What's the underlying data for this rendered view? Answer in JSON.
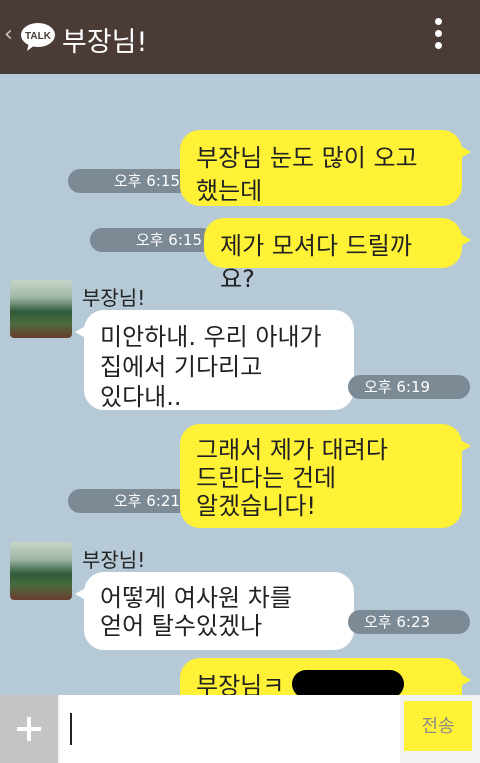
{
  "header": {
    "back_glyph": "‹",
    "logo_text": "TALK",
    "title": "부장님!"
  },
  "messages": [
    {
      "side": "mine",
      "text": "부장님 눈도 많이 오고\n했는데",
      "time": "오후 6:15"
    },
    {
      "side": "mine",
      "text": "제가 모셔다 드릴까요?",
      "time": "오후 6:15"
    },
    {
      "side": "theirs",
      "sender": "부장님!",
      "text": "미안하내. 우리 아내가\n집에서 기다리고\n있다내..",
      "time": "오후 6:19"
    },
    {
      "side": "mine",
      "text": "그래서 제가 대려다\n드린다는 건데\n알겠습니다!",
      "time": "오후 6:21"
    },
    {
      "side": "theirs",
      "sender": "부장님!",
      "text": "어떻게 여사원 차를\n얻어 탈수있겠나",
      "time": "오후 6:23"
    },
    {
      "side": "mine",
      "text": "부장님ㅋ",
      "time": ""
    }
  ],
  "input": {
    "value": "",
    "send_label": "전송"
  },
  "colors": {
    "background": "#b6c9d6",
    "header": "#4a3b36",
    "my_bubble": "#fff236",
    "their_bubble": "#ffffff"
  }
}
